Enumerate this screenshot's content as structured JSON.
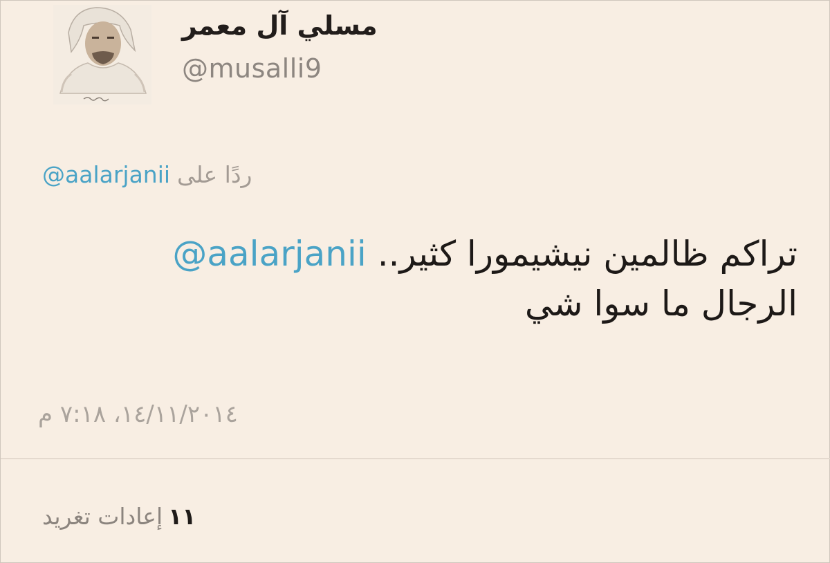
{
  "profile": {
    "display_name": "مسلي آل معمر",
    "handle": "@musalli9",
    "avatar_caption": "آل معمر"
  },
  "reply": {
    "label": "ردًا على",
    "mention": "@aalarjanii"
  },
  "tweet": {
    "mention": "@aalarjanii",
    "line1": "تراكم ظالمين نيشيمورا كثير..",
    "line2": "الرجال ما سوا شي"
  },
  "meta": {
    "timestamp": "١٤/١١/٢٠١٤، ٧:١٨ م"
  },
  "stats": {
    "retweet_count": "١١",
    "retweet_label": "إعادات تغريد"
  },
  "colors": {
    "background": "#f8eee3",
    "link": "#4aa3c6",
    "muted": "#a39b94",
    "text": "#1d1917"
  }
}
